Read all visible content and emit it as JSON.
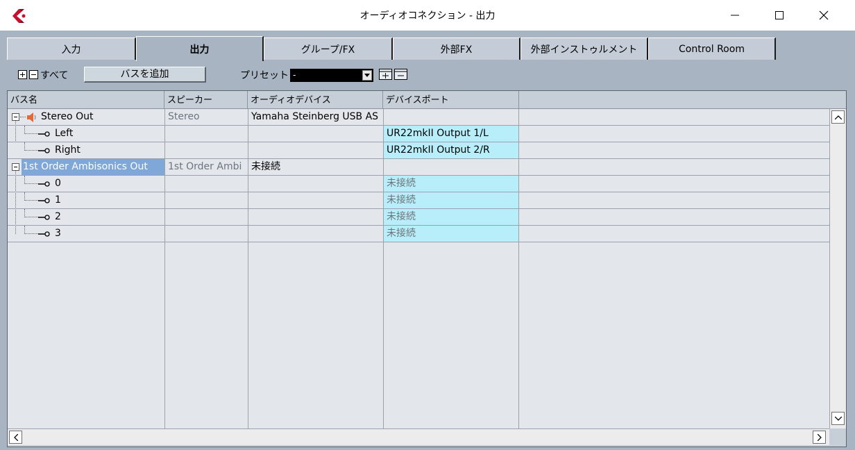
{
  "window": {
    "title": "オーディオコネクション - 出力",
    "minimize": "—",
    "maximize": "☐",
    "close": "✕"
  },
  "tabs": [
    {
      "label": "入力",
      "active": false
    },
    {
      "label": "出力",
      "active": true
    },
    {
      "label": "グループ/FX",
      "active": false
    },
    {
      "label": "外部FX",
      "active": false
    },
    {
      "label": "外部インストゥルメント",
      "active": false
    },
    {
      "label": "Control Room",
      "active": false
    }
  ],
  "toolbar": {
    "expand_icon": "expand-all-icon",
    "collapse_icon": "collapse-all-icon",
    "all_label": "すべて",
    "add_bus_label": "バスを追加",
    "preset_label": "プリセット",
    "preset_value": "-"
  },
  "table": {
    "columns": [
      "バス名",
      "スピーカー",
      "オーディオデバイス",
      "デバイスポート"
    ],
    "rows": [
      {
        "name": "Stereo Out",
        "speaker": "Stereo",
        "device": "Yamaha Steinberg USB AS",
        "port": "",
        "level": 0,
        "icon": "speaker-icon"
      },
      {
        "name": "Left",
        "speaker": "",
        "device": "",
        "port": "UR22mkII Output 1/L",
        "level": 1
      },
      {
        "name": "Right",
        "speaker": "",
        "device": "",
        "port": "UR22mkII Output 2/R",
        "level": 1
      },
      {
        "name": "1st Order Ambisonics Out",
        "speaker": "1st Order Ambi",
        "device": "未接続",
        "port": "",
        "level": 0,
        "selected": true
      },
      {
        "name": "0",
        "speaker": "",
        "device": "",
        "port": "未接続",
        "level": 1
      },
      {
        "name": "1",
        "speaker": "",
        "device": "",
        "port": "未接続",
        "level": 1
      },
      {
        "name": "2",
        "speaker": "",
        "device": "",
        "port": "未接続",
        "level": 1
      },
      {
        "name": "3",
        "speaker": "",
        "device": "",
        "port": "未接続",
        "level": 1
      }
    ]
  },
  "colors": {
    "panel": "#a8b4c2",
    "port_cell": "#b8eefa",
    "selected": "#7fa7d8",
    "logo": "#c8102e"
  }
}
